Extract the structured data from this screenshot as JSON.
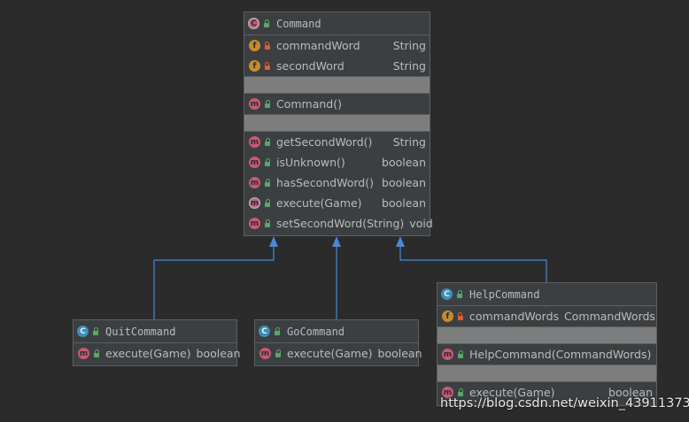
{
  "classes": {
    "command": {
      "name": "Command",
      "fields": [
        {
          "name": "commandWord",
          "type": "String"
        },
        {
          "name": "secondWord",
          "type": "String"
        }
      ],
      "constructors": [
        {
          "name": "Command()",
          "type": ""
        }
      ],
      "methods": [
        {
          "name": "getSecondWord()",
          "type": "String"
        },
        {
          "name": "isUnknown()",
          "type": "boolean"
        },
        {
          "name": "hasSecondWord()",
          "type": "boolean"
        },
        {
          "name": "execute(Game)",
          "type": "boolean"
        },
        {
          "name": "setSecondWord(String)",
          "type": "void"
        }
      ]
    },
    "quit": {
      "name": "QuitCommand",
      "methods": [
        {
          "name": "execute(Game)",
          "type": "boolean"
        }
      ]
    },
    "go": {
      "name": "GoCommand",
      "methods": [
        {
          "name": "execute(Game)",
          "type": "boolean"
        }
      ]
    },
    "help": {
      "name": "HelpCommand",
      "fields": [
        {
          "name": "commandWords",
          "type": "CommandWords"
        }
      ],
      "constructors": [
        {
          "name": "HelpCommand(CommandWords)",
          "type": ""
        }
      ],
      "methods": [
        {
          "name": "execute(Game)",
          "type": "boolean"
        }
      ]
    }
  },
  "icons": {
    "class_badge": "C",
    "field_badge": "f",
    "method_badge": "m"
  },
  "colors": {
    "background": "#2b2b2b",
    "node": "#3c3f41",
    "arrow": "#4a88d8"
  },
  "watermark": "https://blog.csdn.net/weixin_43911373"
}
